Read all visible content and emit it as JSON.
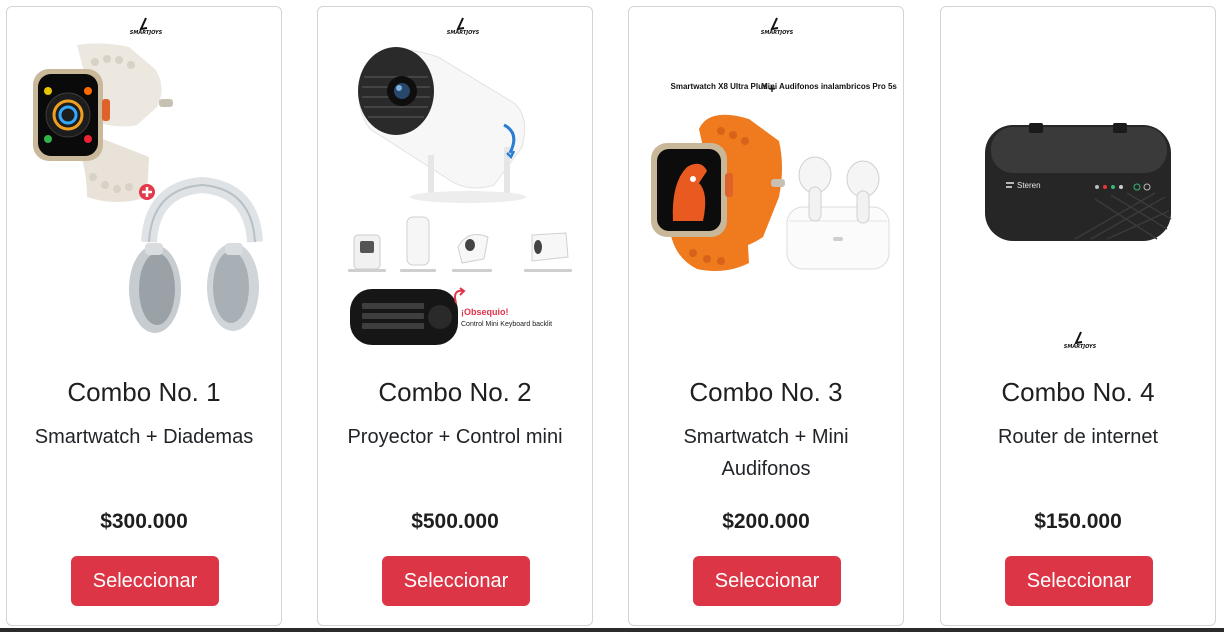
{
  "brand": "SMARTJOYS",
  "colors": {
    "button": "#dc3545",
    "orange_band": "#f07a1e",
    "obsequio_red": "#e0344a"
  },
  "combos": [
    {
      "title": "Combo No. 1",
      "description": "Smartwatch + Diademas",
      "price": "$300.000",
      "button_label": "Seleccionar"
    },
    {
      "title": "Combo No. 2",
      "description": "Proyector + Control mini",
      "price": "$500.000",
      "button_label": "Seleccionar"
    },
    {
      "title": "Combo No. 3",
      "description": "Smartwatch + Mini Audifonos",
      "price": "$200.000",
      "button_label": "Seleccionar"
    },
    {
      "title": "Combo No. 4",
      "description": "Router de internet",
      "price": "$150.000",
      "button_label": "Seleccionar"
    }
  ],
  "combo2_image": {
    "gift_label": "¡Obsequio!",
    "gift_caption": "Control Mini Keyboard backlit"
  },
  "combo3_image": {
    "label_left": "Smartwatch X8 Ultra Plus",
    "label_plus": "+",
    "label_right": "Mini Audifonos inalambricos Pro 5s"
  },
  "combo4_image": {
    "router_brand": "Steren"
  }
}
